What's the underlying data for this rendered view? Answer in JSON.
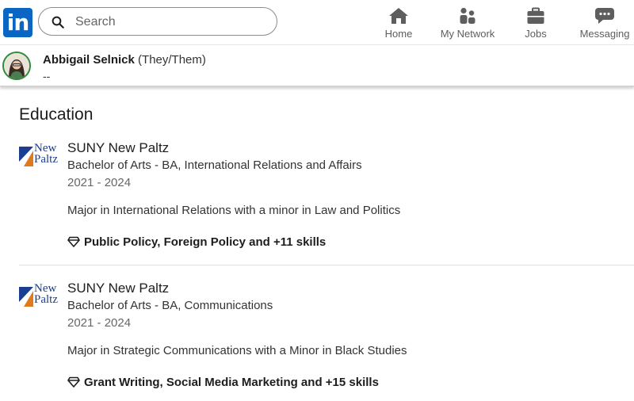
{
  "app": {
    "logo_text": "in",
    "brand_color": "#0a66c2"
  },
  "search": {
    "placeholder": "Search",
    "value": ""
  },
  "nav": {
    "items": [
      {
        "label": "Home",
        "icon": "home-icon"
      },
      {
        "label": "My Network",
        "icon": "my-network-icon"
      },
      {
        "label": "Jobs",
        "icon": "briefcase-icon"
      },
      {
        "label": "Messaging",
        "icon": "messaging-icon"
      }
    ]
  },
  "profile": {
    "name": "Abbigail Selnick",
    "pronouns": "(They/Them)",
    "headline": "--"
  },
  "education": {
    "title": "Education",
    "entries": [
      {
        "school": "SUNY New Paltz",
        "logo_words": [
          "New",
          "Paltz"
        ],
        "degree": "Bachelor of Arts - BA, International Relations and Affairs",
        "dates": "2021 - 2024",
        "description": "Major in International Relations with a minor in Law and Politics",
        "skills": "Public Policy, Foreign Policy and +11 skills"
      },
      {
        "school": "SUNY New Paltz",
        "logo_words": [
          "New",
          "Paltz"
        ],
        "degree": "Bachelor of Arts - BA, Communications",
        "dates": "2021 - 2024",
        "description": "Major in Strategic Communications with a Minor in Black Studies",
        "skills": "Grant Writing, Social Media Marketing and +15 skills"
      }
    ]
  }
}
